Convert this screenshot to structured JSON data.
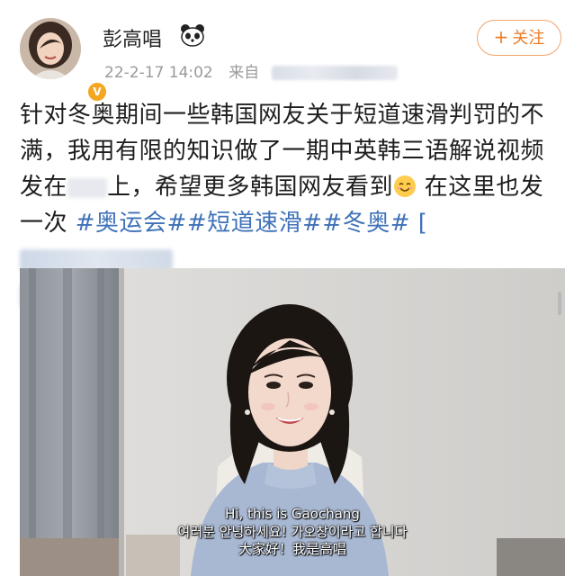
{
  "user": {
    "name": "彭高唱",
    "badge_icon": "panda-icon",
    "verified_icon": "verified-badge-icon",
    "date": "22-2-17 14:02",
    "from_label": "来自"
  },
  "follow_button": {
    "plus": "+",
    "label": "关注"
  },
  "post": {
    "line1": "针对冬奥期间一些韩国网友关于短道速滑判罚的不",
    "line2": "满，我用有限的知识做了一期中英韩三语解说视频",
    "line3_a": "发在",
    "line3_b": "上，希望更多韩国网友看到",
    "line3_c": " 在这里也发",
    "line4_a": "一次 ",
    "hashtags": [
      "#奥运会#",
      "#短道速滑#",
      "#冬奥#"
    ],
    "line4_tail": " "
  },
  "video": {
    "subtitle_en": "Hi, this is Gaochang",
    "subtitle_ko": "여러분 안녕하세요! 가오창이라고 합니다",
    "subtitle_zh": "大家好！我是高唱"
  },
  "colors": {
    "hashtag": "#3f72b8",
    "follow": "#ef7b24",
    "verified": "#f5a623"
  }
}
